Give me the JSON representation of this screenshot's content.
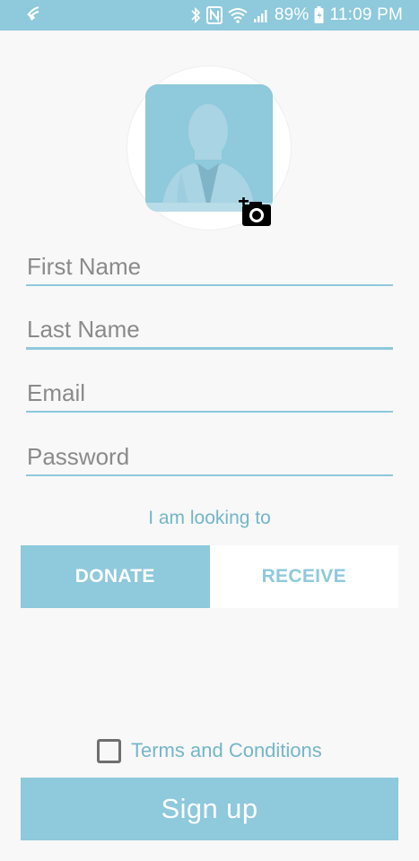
{
  "status_bar": {
    "icons": [
      "wifi-call-icon",
      "bluetooth-icon",
      "nfc-icon",
      "wifi-icon",
      "signal-icon",
      "battery-charging-icon"
    ],
    "battery": "89%",
    "time": "11:09 PM"
  },
  "avatar": {
    "icon": "person-silhouette-icon",
    "camera_icon": "add-photo-icon"
  },
  "form": {
    "first_name_placeholder": "First Name",
    "last_name_placeholder": "Last Name",
    "email_placeholder": "Email",
    "password_placeholder": "Password"
  },
  "looking_to": {
    "label": "I am looking to",
    "options": [
      "DONATE",
      "RECEIVE"
    ],
    "selected": "DONATE"
  },
  "terms": {
    "label": "Terms and Conditions",
    "checked": false
  },
  "signup_label": "Sign up",
  "colors": {
    "accent": "#8ec9dc",
    "accent_text": "#74b6c9",
    "background": "#f8f8f8"
  }
}
